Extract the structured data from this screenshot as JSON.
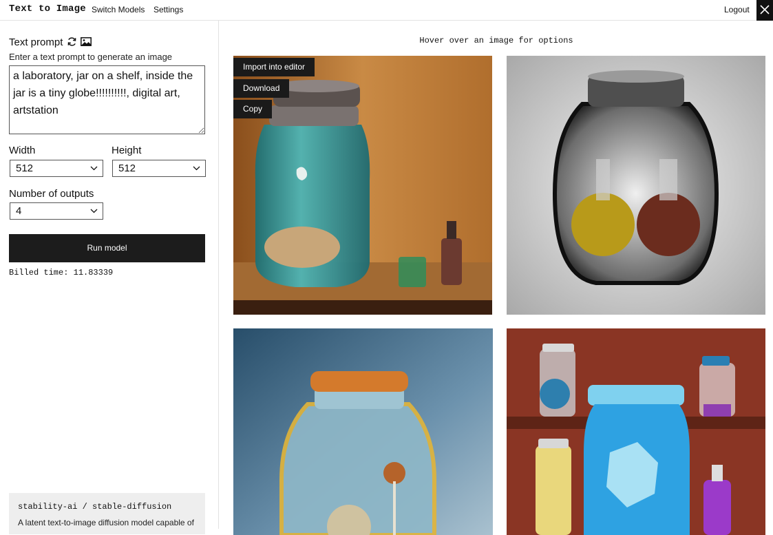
{
  "header": {
    "app_title": "Text to Image",
    "nav": {
      "switch_models": "Switch Models",
      "settings": "Settings",
      "logout": "Logout"
    }
  },
  "form": {
    "prompt_heading": "Text prompt",
    "prompt_help": "Enter a text prompt to generate an image",
    "prompt_value": "a laboratory, jar on a shelf, inside the jar is a tiny globe!!!!!!!!!!, digital art, artstation",
    "width_label": "Width",
    "width_value": "512",
    "height_label": "Height",
    "height_value": "512",
    "outputs_label": "Number of outputs",
    "outputs_value": "4",
    "run_label": "Run model",
    "billed_label": "Billed time:",
    "billed_value": "11.83339"
  },
  "model": {
    "name": "stability-ai / stable-diffusion",
    "description": "A latent text-to-image diffusion model capable of"
  },
  "results": {
    "hint": "Hover over an image for options",
    "menu": {
      "import": "Import into editor",
      "download": "Download",
      "copy": "Copy"
    }
  },
  "icons": {
    "refresh": "refresh-icon",
    "image": "image-icon",
    "chevron": "chevron-down-icon",
    "close": "close-icon"
  },
  "colors": {
    "dark": "#1c1c1c",
    "panel_gray": "#eeeeee",
    "border": "#e2e2e2"
  }
}
